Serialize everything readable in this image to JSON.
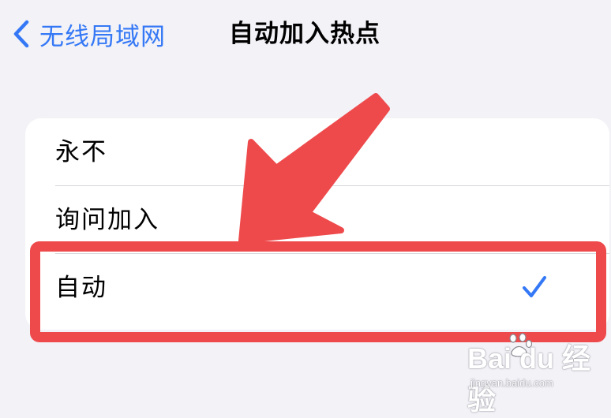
{
  "nav": {
    "back_label": "无线局域网",
    "title": "自动加入热点"
  },
  "options": [
    {
      "label": "永不",
      "selected": false
    },
    {
      "label": "询问加入",
      "selected": false
    },
    {
      "label": "自动",
      "selected": true
    }
  ],
  "colors": {
    "accent": "#3478f6",
    "annotation_red": "#ee4a4c",
    "background": "#f2f2f7",
    "card": "#ffffff"
  },
  "icons": {
    "back": "chevron-left-icon",
    "selected": "checkmark-icon",
    "annotation": "red-arrow-icon"
  },
  "watermark": {
    "logo": "Bai du 经验",
    "sub": "jingyan.baidu.com"
  }
}
